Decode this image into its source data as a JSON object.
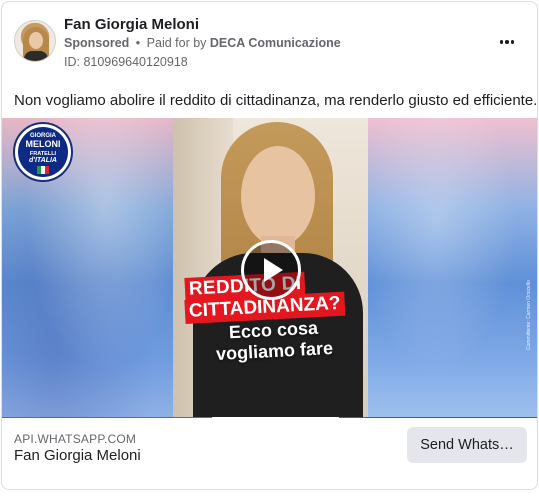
{
  "header": {
    "page_name": "Fan Giorgia Meloni",
    "sponsored": "Sponsored",
    "separator": "•",
    "paid_for_prefix": "Paid for by",
    "paid_for_by": "DECA Comunicazione",
    "ad_id": "ID: 810969640120918"
  },
  "body_text": "Non vogliamo abolire il reddito di cittadinanza, ma renderlo giusto ed efficiente.",
  "media": {
    "logo": {
      "line1": "GIORGIA",
      "line2": "MELONI",
      "line3": "FRATELLI",
      "line4": "d'ITALIA"
    },
    "title_line1": "REDDITO DI",
    "title_line2": "CITTADINANZA?",
    "subtitle": "Ecco cosa vogliamo fare",
    "credit": "Committente: Carmen Orsicello",
    "colors": {
      "red": "#e3171f",
      "green": "#1f9b3c",
      "blue": "#0d2a85"
    }
  },
  "footer": {
    "domain": "API.WHATSAPP.COM",
    "title": "Fan Giorgia Meloni",
    "cta_label": "Send Whats…"
  },
  "icons": {
    "more": "more-horizontal-icon",
    "play": "play-icon"
  }
}
